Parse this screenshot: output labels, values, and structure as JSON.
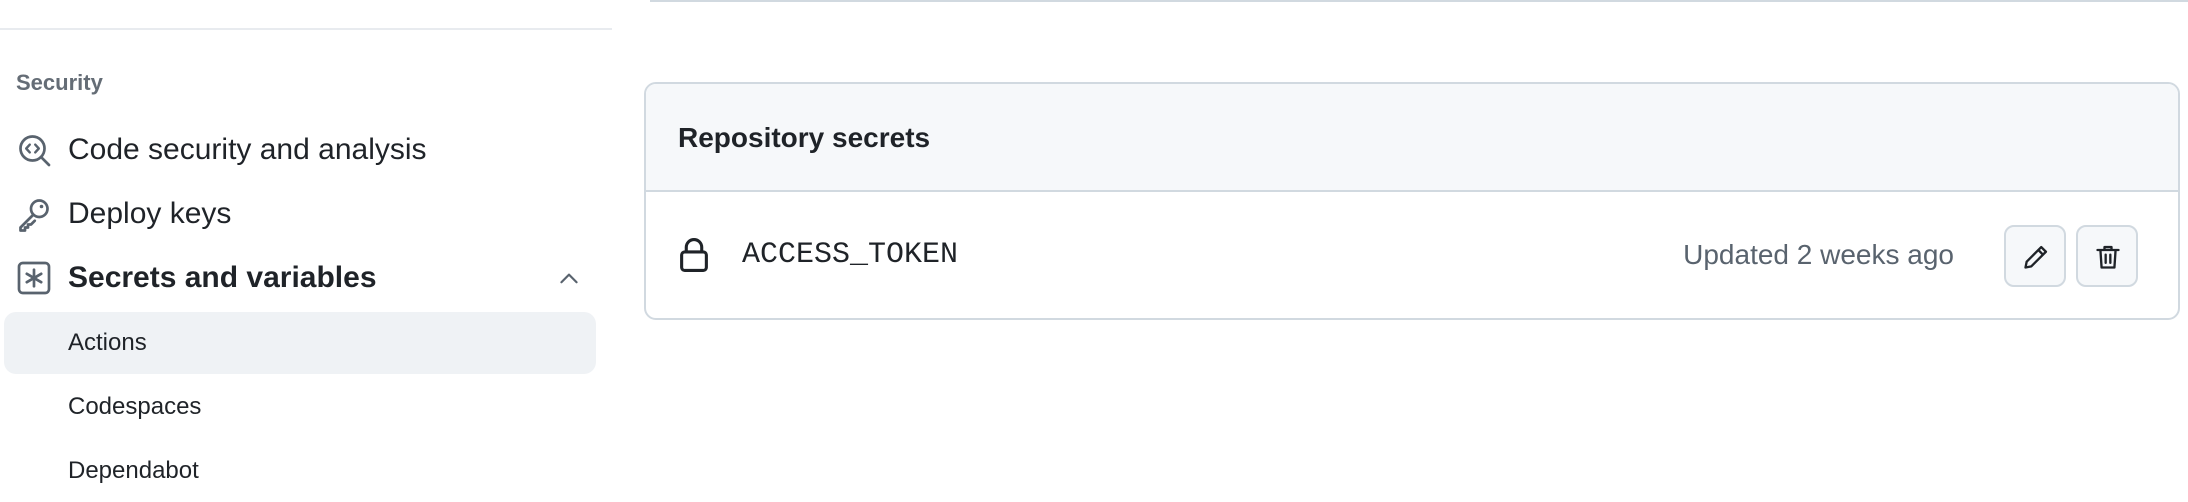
{
  "sidebar": {
    "section_heading": "Security",
    "items": [
      {
        "label": "Code security and analysis",
        "icon": "codescan-icon"
      },
      {
        "label": "Deploy keys",
        "icon": "key-icon"
      },
      {
        "label": "Secrets and variables",
        "icon": "asterisk-icon",
        "expanded": true
      }
    ],
    "sub_items": [
      {
        "label": "Actions",
        "active": true
      },
      {
        "label": "Codespaces",
        "active": false
      },
      {
        "label": "Dependabot",
        "active": false
      }
    ]
  },
  "main": {
    "panel_title": "Repository secrets",
    "secrets": [
      {
        "name": "ACCESS_TOKEN",
        "updated": "Updated 2 weeks ago",
        "icon": "lock-icon"
      }
    ],
    "actions": {
      "edit_icon": "pencil-icon",
      "delete_icon": "trash-icon"
    }
  },
  "colors": {
    "text_primary": "#1f2328",
    "text_muted": "#656d76",
    "border": "#d1d9e0",
    "header_bg": "#f6f8fa",
    "active_bg": "#eff2f5"
  }
}
